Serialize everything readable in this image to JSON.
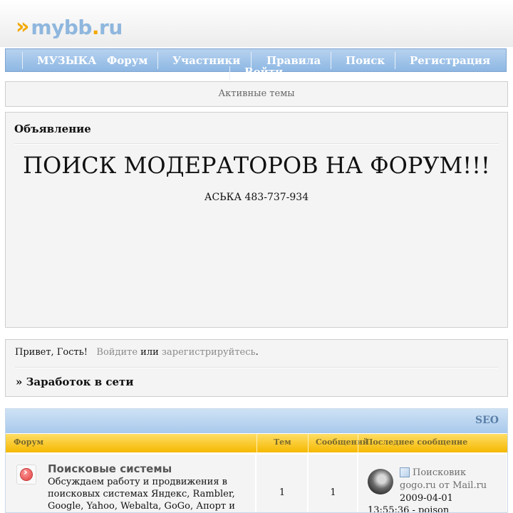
{
  "logo": {
    "arrows": "»",
    "name": "mybb",
    "dot": ".",
    "tld": "ru"
  },
  "navbar": {
    "items": [
      "МУЗЫКА",
      "Форум",
      "Участники",
      "Правила",
      "Поиск",
      "Регистрация",
      "Войти"
    ]
  },
  "active_topics": "Активные темы",
  "announcement": {
    "heading": "Объявление",
    "title": "ПОИСК МОДЕРАТОРОВ НА ФОРУМ!!!",
    "contact": "АСЬКА 483-737-934"
  },
  "welcome": {
    "greeting": "Привет, Гость!",
    "login": "Войдите",
    "or": "или",
    "register": "зарегистрируйтесь",
    "end": ".",
    "section": "» Заработок в сети"
  },
  "category": {
    "title": "SEO",
    "columns": {
      "forum": "Форум",
      "topics": "Тем",
      "posts": "Сообщений",
      "last_post": "Последнее сообщение"
    },
    "forums": [
      {
        "name": "Поисковые системы",
        "description": "Обсуждаем работу и продвижения в поисковых системах Яндекс, Rambler, Google, Yahoo, Webalta, GoGo, Апорт и",
        "topics": "1",
        "posts": "1",
        "last_post": {
          "title": "Поисковик",
          "source": "gogo.ru от Mail.ru",
          "date": "2009-04-01",
          "time_author": "13:55:36 - poison"
        }
      }
    ]
  },
  "colors": {
    "nav_bg": "#8db7e3",
    "column_header": "#f5b800",
    "panel_bg": "#f4f4f4",
    "logo_accent": "#f2a900",
    "logo_text": "#8fb7de"
  },
  "icons": [
    "forum-status-icon",
    "post-icon",
    "user-avatar"
  ]
}
